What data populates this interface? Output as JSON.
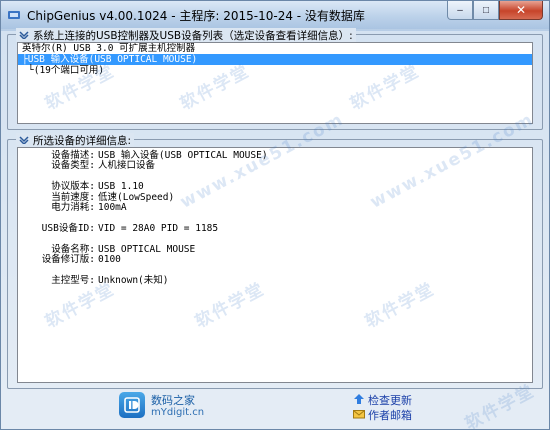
{
  "window": {
    "title": "ChipGenius v4.00.1024 - 主程序: 2015-10-24 - 没有数据库",
    "accent_color": "#3399ff",
    "buttons": {
      "minimize": "–",
      "maximize": "□",
      "close": "✕"
    }
  },
  "device_list": {
    "legend": "系统上连接的USB控制器及USB设备列表（选定设备查看详细信息）:",
    "controller": "英特尔(R) USB 3.0 可扩展主机控制器",
    "selected_device": "├USB 输入设备(USB OPTICAL MOUSE)",
    "port_info": "└(19个端口可用)"
  },
  "details": {
    "legend": "所选设备的详细信息:",
    "rows": [
      {
        "label": "设备描述:",
        "value": "USB 输入设备(USB OPTICAL MOUSE)"
      },
      {
        "label": "设备类型:",
        "value": "人机接口设备"
      },
      {
        "label": "协议版本:",
        "value": "USB 1.10"
      },
      {
        "label": "当前速度:",
        "value": "低速(LowSpeed)"
      },
      {
        "label": "电力消耗:",
        "value": "100mA"
      },
      {
        "label": "USB设备ID:",
        "value": "VID = 28A0 PID = 1185"
      },
      {
        "label": "设备名称:",
        "value": "USB OPTICAL MOUSE"
      },
      {
        "label": "设备修订版:",
        "value": "0100"
      },
      {
        "label": "主控型号:",
        "value": "Unknown(未知)"
      }
    ]
  },
  "footer": {
    "home_name": "数码之家",
    "home_url": "mYdigit.cn",
    "check_update": "检查更新",
    "author_email": "作者邮箱"
  },
  "watermarks": [
    "软件学堂",
    "www.xue51.com"
  ]
}
